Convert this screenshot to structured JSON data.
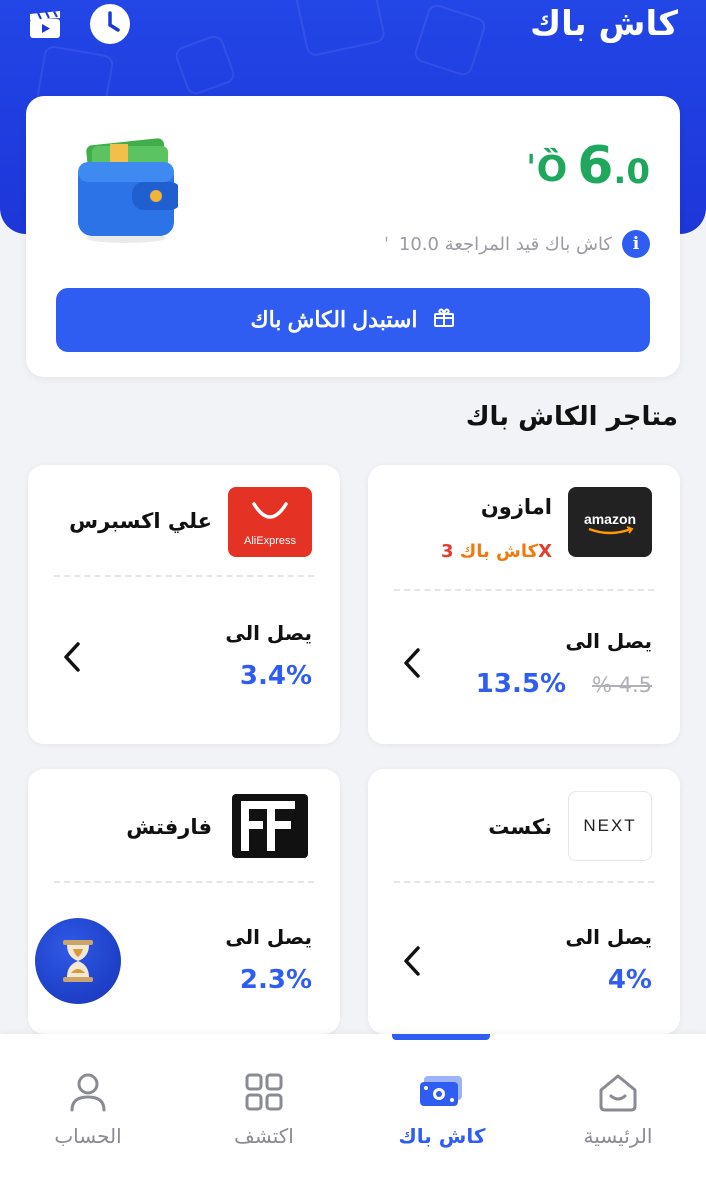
{
  "header": {
    "title": "كاش باك",
    "icons": [
      "clapperboard-icon",
      "clock-icon"
    ]
  },
  "summary": {
    "amount_int": "6",
    "amount_dec": ".0",
    "currency_symbol": "ريال-symbol",
    "pending_text": "كاش باك قيد المراجعة 10.0",
    "redeem_label": "استبدل الكاش باك"
  },
  "section": {
    "title": "متاجر الكاش باك"
  },
  "stores": [
    {
      "name": "امازون",
      "logo_text": "amazon",
      "badge_mult": "3X",
      "badge_text": "كاش باك",
      "reach_label": "يصل الى",
      "rate": "13.5%",
      "old_rate": "% 4.5"
    },
    {
      "name": "علي اكسبرس",
      "logo_text": "AliExpress",
      "reach_label": "يصل الى",
      "rate": "3.4%"
    },
    {
      "name": "نكست",
      "logo_text": "NEXT",
      "reach_label": "يصل الى",
      "rate": "4%"
    },
    {
      "name": "فارفتش",
      "logo_text": "FF",
      "reach_label": "يصل الى",
      "rate": "2.3%"
    }
  ],
  "nav": {
    "items": [
      {
        "label": "الرئيسية",
        "icon": "home-icon"
      },
      {
        "label": "كاش باك",
        "icon": "cash-icon",
        "active": true
      },
      {
        "label": "اكتشف",
        "icon": "grid-icon"
      },
      {
        "label": "الحساب",
        "icon": "user-icon"
      }
    ]
  },
  "colors": {
    "primary": "#2f5df2",
    "header": "#1d36d8",
    "success": "#1fa85d",
    "badge": "#f07a10"
  }
}
